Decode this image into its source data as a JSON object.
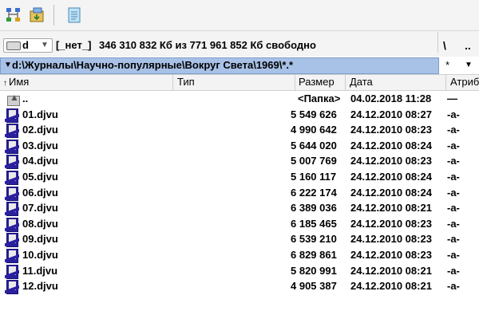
{
  "toolbar": {
    "buttons": [
      {
        "icon": "network-tree-icon"
      },
      {
        "icon": "archive-box-icon"
      },
      {
        "icon": "notepad-icon"
      }
    ]
  },
  "drive": {
    "letter": "d",
    "label": "[_нет_]",
    "space_info": "346 310 832 Кб из 771 961 852 Кб свободно",
    "root_button": "\\",
    "up_button": ".."
  },
  "path": {
    "text": "d:\\Журналы\\Научно-популярные\\Вокруг Света\\1969\\*.*",
    "history_button": "*"
  },
  "columns": {
    "name": "Имя",
    "type": "Тип",
    "size": "Размер",
    "date": "Дата",
    "attr": "Атриб"
  },
  "parent_row": {
    "name": "..",
    "size": "<Папка>",
    "date": "04.02.2018 11:28",
    "attr": "—"
  },
  "files": [
    {
      "name": "01.djvu",
      "size": "5 549 626",
      "date": "24.12.2010 08:27",
      "attr": "-a-"
    },
    {
      "name": "02.djvu",
      "size": "4 990 642",
      "date": "24.12.2010 08:23",
      "attr": "-a-"
    },
    {
      "name": "03.djvu",
      "size": "5 644 020",
      "date": "24.12.2010 08:24",
      "attr": "-a-"
    },
    {
      "name": "04.djvu",
      "size": "5 007 769",
      "date": "24.12.2010 08:23",
      "attr": "-a-"
    },
    {
      "name": "05.djvu",
      "size": "5 160 117",
      "date": "24.12.2010 08:24",
      "attr": "-a-"
    },
    {
      "name": "06.djvu",
      "size": "6 222 174",
      "date": "24.12.2010 08:24",
      "attr": "-a-"
    },
    {
      "name": "07.djvu",
      "size": "6 389 036",
      "date": "24.12.2010 08:21",
      "attr": "-a-"
    },
    {
      "name": "08.djvu",
      "size": "6 185 465",
      "date": "24.12.2010 08:23",
      "attr": "-a-"
    },
    {
      "name": "09.djvu",
      "size": "6 539 210",
      "date": "24.12.2010 08:23",
      "attr": "-a-"
    },
    {
      "name": "10.djvu",
      "size": "6 829 861",
      "date": "24.12.2010 08:23",
      "attr": "-a-"
    },
    {
      "name": "11.djvu",
      "size": "5 820 991",
      "date": "24.12.2010 08:21",
      "attr": "-a-"
    },
    {
      "name": "12.djvu",
      "size": "4 905 387",
      "date": "24.12.2010 08:21",
      "attr": "-a-"
    }
  ],
  "colors": {
    "path_bar": "#a8c1e6",
    "djvu_icon": "#2a1f9e"
  }
}
